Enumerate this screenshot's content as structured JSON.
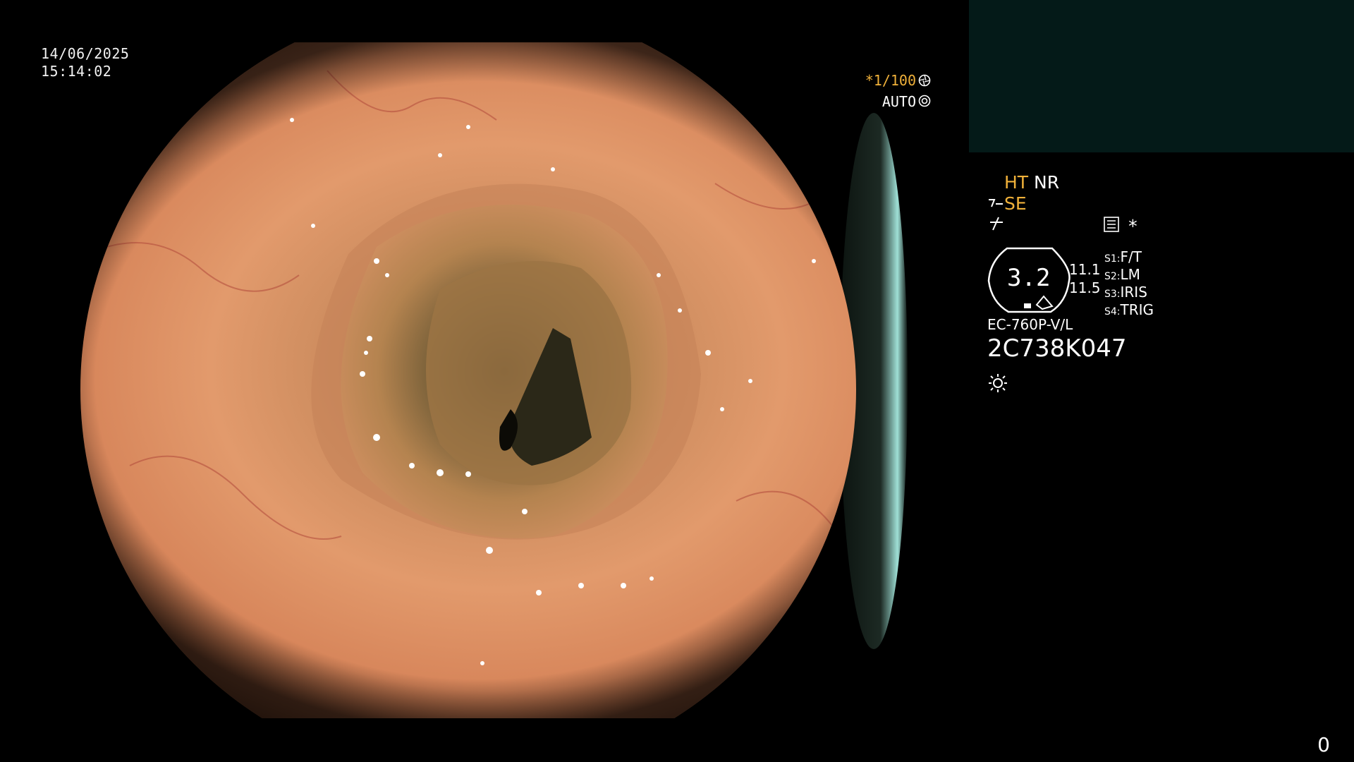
{
  "datetime": {
    "date": "14/06/2025",
    "time": "15:14:02"
  },
  "shutter": {
    "value": "*1/100",
    "mode": "AUTO"
  },
  "panel": {
    "ht": "HT",
    "nr": "NR",
    "se": "SE",
    "star": "*",
    "gauge_value": "3.2",
    "readings": [
      "11.1",
      "11.5"
    ],
    "switches": [
      {
        "key": "S1:",
        "value": "F/T"
      },
      {
        "key": "S2:",
        "value": "LM"
      },
      {
        "key": "S3:",
        "value": "IRIS"
      },
      {
        "key": "S4:",
        "value": "TRIG"
      }
    ],
    "model": "EC-760P-V/L",
    "serial": "2C738K047"
  },
  "counter": "0",
  "colors": {
    "accent": "#f0b13a",
    "thumbnail": "#041a18",
    "background": "#000000"
  },
  "icons": [
    "aperture-icon",
    "auto-iris-icon",
    "scope-hook-icon",
    "tilde-slash-icon",
    "keypad-icon",
    "brightness-icon"
  ]
}
